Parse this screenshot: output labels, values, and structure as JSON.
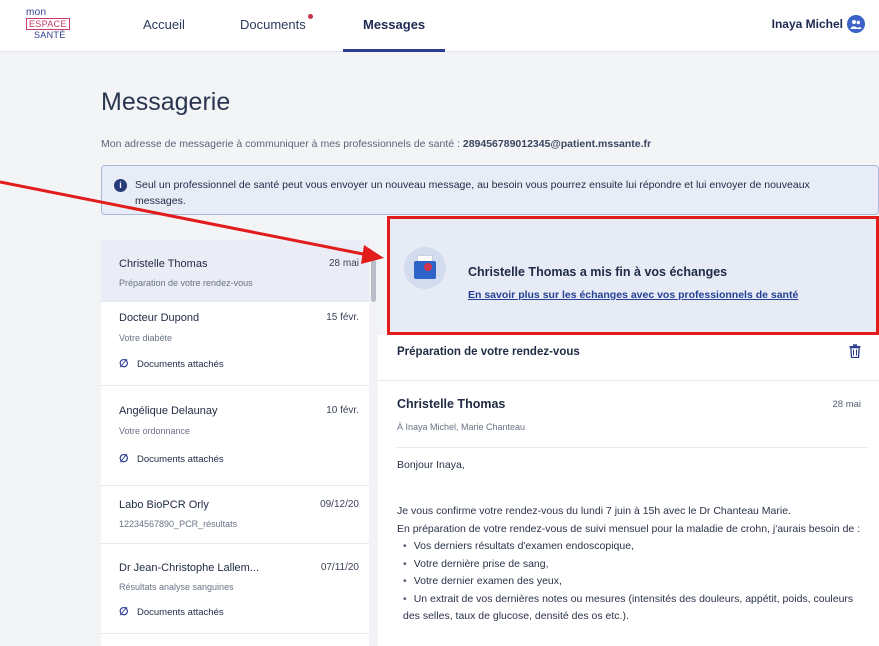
{
  "header": {
    "logo_line1": "mon",
    "logo_line2": "ESPACE",
    "logo_line3": "SANTÉ",
    "nav": [
      "Accueil",
      "Documents",
      "Messages"
    ],
    "active_nav": "Messages",
    "user_name": "Inaya Michel",
    "colors": {
      "brand": "#2b3c8e",
      "accent": "#c83a63"
    }
  },
  "page": {
    "title": "Messagerie",
    "address_label": "Mon adresse de messagerie à communiquer à mes professionnels de santé : ",
    "address_value": "289456789012345@patient.mssante.fr",
    "info_text": "Seul un professionnel de santé peut vous envoyer un nouveau message, au besoin vous pourrez ensuite lui répondre et lui envoyer de nouveaux messages."
  },
  "messages": [
    {
      "name": "Christelle Thomas",
      "date": "28 mai",
      "subject": "Préparation de votre rendez-vous",
      "attachments": ""
    },
    {
      "name": "Docteur Dupond",
      "date": "15 févr.",
      "subject": "Votre diabète",
      "attachments": "Documents attachés"
    },
    {
      "name": "Angélique Delaunay",
      "date": "10 févr.",
      "subject": "Votre ordonnance",
      "attachments": "Documents attachés"
    },
    {
      "name": "Labo BioPCR Orly",
      "date": "09/12/20",
      "subject": "12234567890_PCR_résultats",
      "attachments": ""
    },
    {
      "name": "Dr Jean-Christophe Lallem...",
      "date": "07/11/20",
      "subject": "Résultats analyse sanguines",
      "attachments": "Documents attachés"
    }
  ],
  "banner": {
    "title": "Christelle Thomas a mis fin à vos échanges",
    "link": "En savoir plus sur les échanges avec vos professionnels de santé"
  },
  "detail": {
    "subject": "Préparation de votre rendez-vous",
    "sender": "Christelle Thomas",
    "date": "28 mai",
    "recipients": "À Inaya Michel, Marie Chanteau",
    "greeting": "Bonjour Inaya,",
    "line1": "Je vous confirme votre rendez-vous du lundi 7 juin à 15h avec le Dr Chanteau Marie.",
    "line2": "En préparation de votre rendez-vous de suivi mensuel pour la maladie de crohn, j'aurais besoin de :",
    "bullets": [
      "Vos derniers résultats d'examen endoscopique,",
      "Votre dernière prise de sang,",
      "Votre dernier examen des yeux,",
      "Un extrait de vos dernières notes ou mesures (intensités des douleurs, appétit, poids, couleurs des selles, taux de glucose, densité des os etc.)."
    ]
  },
  "annotation": {
    "color": "#e21b1b"
  }
}
